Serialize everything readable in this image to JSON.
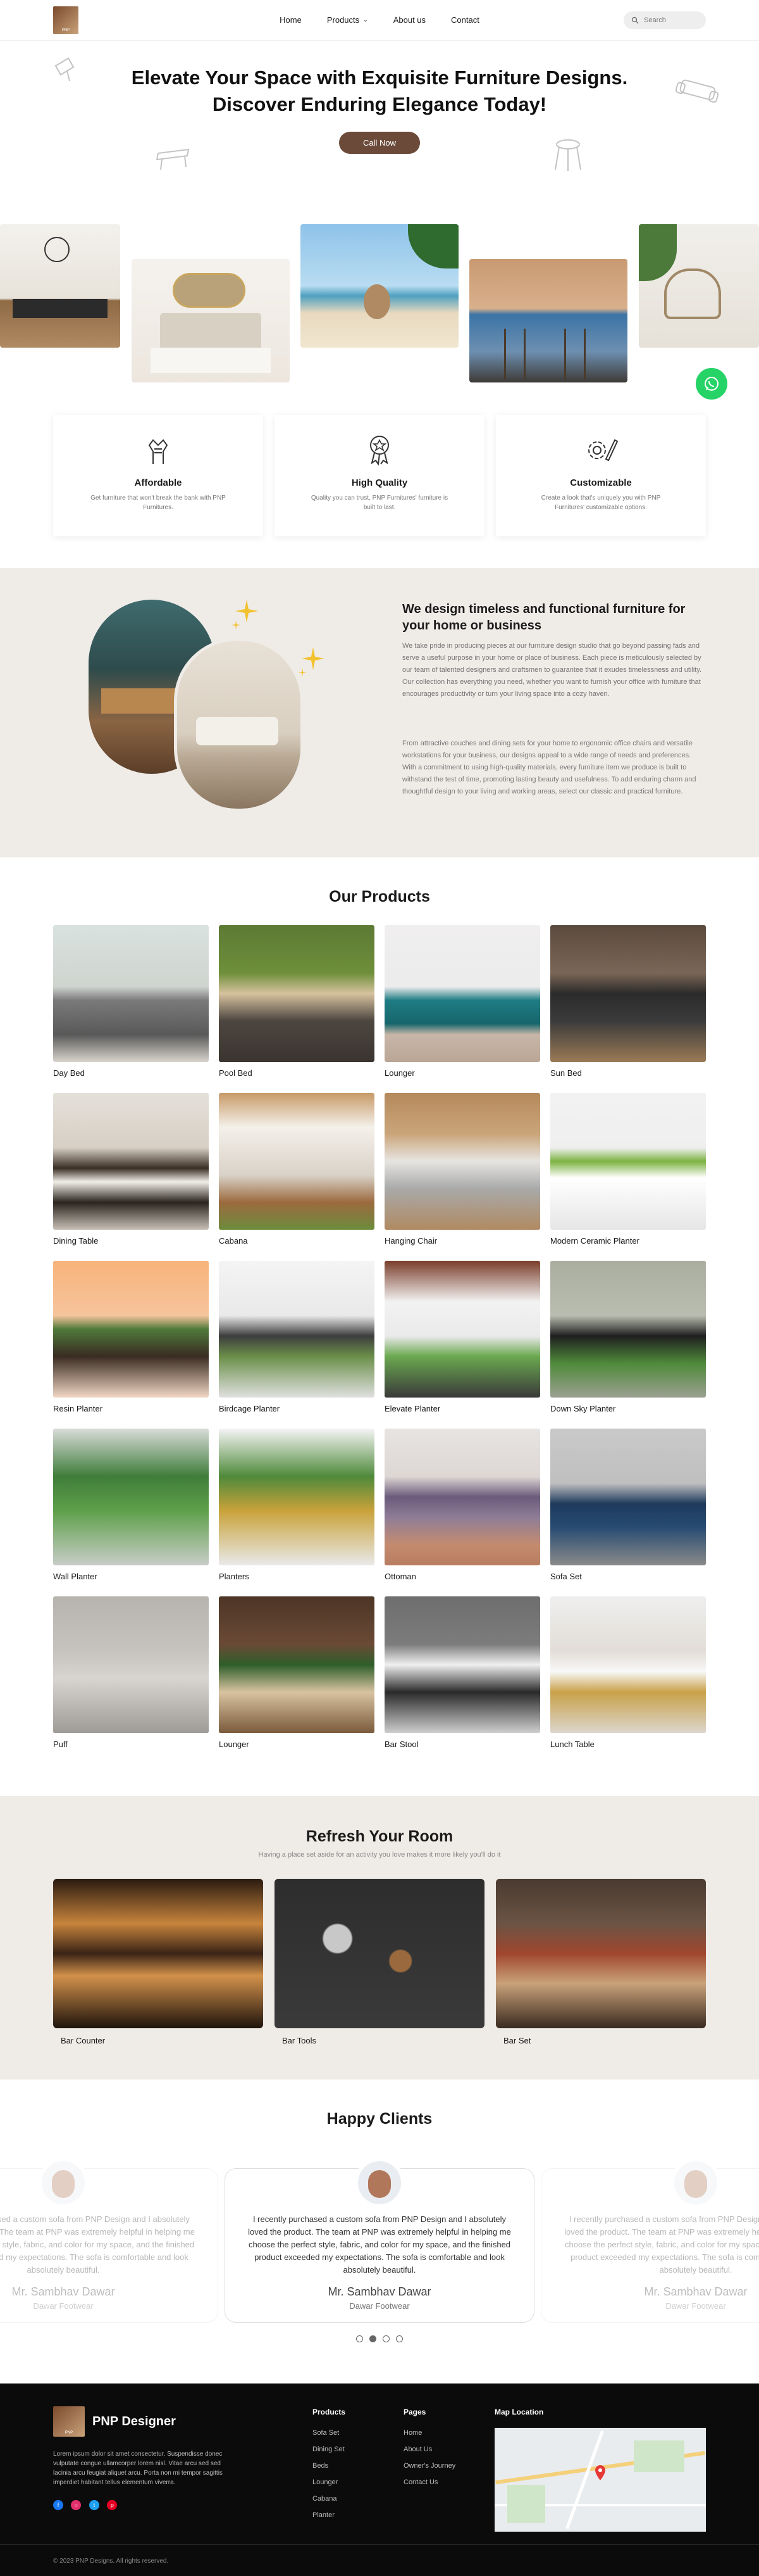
{
  "brand": {
    "logo_text": "PNP",
    "footer_name": "PNP Designer"
  },
  "nav": {
    "links": [
      {
        "label": "Home"
      },
      {
        "label": "Products"
      },
      {
        "label": "About us"
      },
      {
        "label": "Contact"
      }
    ],
    "search_placeholder": "Search"
  },
  "hero": {
    "title_line1": "Elevate Your Space with Exquisite Furniture Designs.",
    "title_line2": "Discover Enduring Elegance Today!",
    "cta": "Call Now"
  },
  "features": [
    {
      "title": "Affordable",
      "text": "Get furniture that won't break the bank with PNP Furnitures.",
      "icon": "handshake-icon"
    },
    {
      "title": "High Quality",
      "text": "Quality you can trust, PNP Furnitures' furniture is built to last.",
      "icon": "award-badge-icon"
    },
    {
      "title": "Customizable",
      "text": "Create a look that's uniquely you with PNP Furnitures' customizable options.",
      "icon": "gear-pencil-icon"
    }
  ],
  "about": {
    "heading": "We design timeless and functional furniture for your home or business",
    "para1": "We take pride in producing pieces at our furniture design studio that go beyond passing fads and serve a useful purpose in your home or place of business. Each piece is meticulously selected by our team of talented designers and craftsmen to guarantee that it exudes timelessness and utility. Our collection has everything you need, whether you want to furnish your office with furniture that encourages productivity or turn your living space into a cozy haven.",
    "para2": "From attractive couches and dining sets for your home to ergonomic office chairs and versatile workstations for your business, our designs appeal to a wide range of needs and preferences. With a commitment to using high-quality materials, every furniture item we produce is built to withstand the test of time, promoting lasting beauty and usefulness. To add enduring charm and thoughtful design to your living and working areas, select our classic and practical furniture."
  },
  "products": {
    "heading": "Our Products",
    "items": [
      {
        "name": "Day Bed"
      },
      {
        "name": "Pool Bed"
      },
      {
        "name": "Lounger"
      },
      {
        "name": "Sun Bed"
      },
      {
        "name": "Dining Table"
      },
      {
        "name": "Cabana"
      },
      {
        "name": "Hanging Chair"
      },
      {
        "name": "Modern Ceramic Planter"
      },
      {
        "name": "Resin Planter"
      },
      {
        "name": "Birdcage Planter"
      },
      {
        "name": "Elevate Planter"
      },
      {
        "name": "Down Sky Planter"
      },
      {
        "name": "Wall Planter"
      },
      {
        "name": "Planters"
      },
      {
        "name": "Ottoman"
      },
      {
        "name": "Sofa Set"
      },
      {
        "name": "Puff"
      },
      {
        "name": "Lounger"
      },
      {
        "name": "Bar Stool"
      },
      {
        "name": "Lunch Table"
      }
    ]
  },
  "refresh": {
    "heading": "Refresh Your Room",
    "subtitle": "Having a place set aside for an activity you love makes it more likely you'll do it",
    "items": [
      {
        "name": "Bar Counter"
      },
      {
        "name": "Bar Tools"
      },
      {
        "name": "Bar Set"
      }
    ]
  },
  "clients": {
    "heading": "Happy Clients",
    "testimonial": "I recently purchased a custom sofa from PNP Design and I absolutely loved the product. The team at PNP was extremely helpful in helping me choose the perfect style, fabric, and color for my space, and the finished product exceeded my expectations. The sofa is comfortable and look absolutely beautiful.",
    "name": "Mr. Sambhav Dawar",
    "role": "Dawar Footwear"
  },
  "footer": {
    "about": "Lorem ipsum dolor sit amet consectetur. Suspendisse donec vulputate congue ullamcorper lorem nisl. Vitae arcu sed sed lacinia arcu feugiat aliquet arcu. Porta non mi tempor sagittis imperdiet habitant tellus elementum viverra.",
    "products_title": "Products",
    "products_links": [
      "Sofa Set",
      "Dining Set",
      "Beds",
      "Lounger",
      "Cabana",
      "Planter"
    ],
    "pages_title": "Pages",
    "pages_links": [
      "Home",
      "About Us",
      "Owner's Journey",
      "Contact Us"
    ],
    "map_title": "Map Location",
    "copyright": "© 2023 PNP Designs. All rights reserved."
  },
  "colors": {
    "accent_brown": "#6b4a3a",
    "section_beige": "#efebe7",
    "footer_bg": "#0b0b0b",
    "whatsapp": "#25d366"
  }
}
